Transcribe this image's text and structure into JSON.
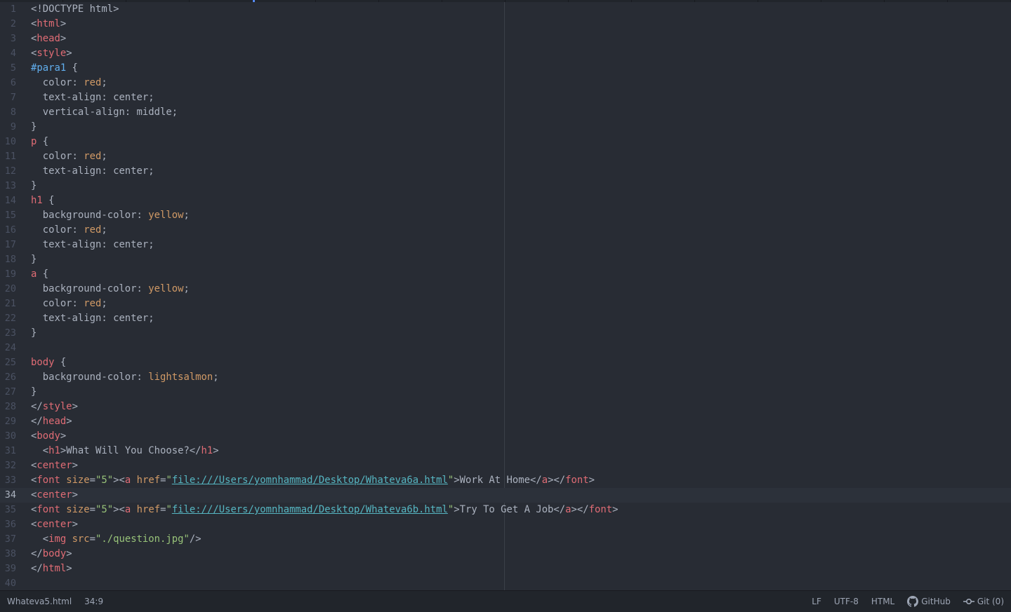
{
  "tabs": [
    "",
    "",
    "",
    "",
    "",
    "",
    "",
    "",
    "",
    "",
    "",
    "",
    "",
    "",
    "",
    ""
  ],
  "editor": {
    "lines": [
      [
        [
          "punc",
          "<!DOCTYPE html>"
        ]
      ],
      [
        [
          "punc",
          "<"
        ],
        [
          "tag",
          "html"
        ],
        [
          "punc",
          ">"
        ]
      ],
      [
        [
          "punc",
          "<"
        ],
        [
          "tag",
          "head"
        ],
        [
          "punc",
          ">"
        ]
      ],
      [
        [
          "punc",
          "<"
        ],
        [
          "tag",
          "style"
        ],
        [
          "punc",
          ">"
        ]
      ],
      [
        [
          "id",
          "#para1"
        ],
        [
          "punc",
          " {"
        ]
      ],
      [
        [
          "punc",
          "  color: "
        ],
        [
          "val",
          "red"
        ],
        [
          "punc",
          ";"
        ]
      ],
      [
        [
          "punc",
          "  text-align: center;"
        ]
      ],
      [
        [
          "punc",
          "  vertical-align: middle;"
        ]
      ],
      [
        [
          "punc",
          "}"
        ]
      ],
      [
        [
          "tag",
          "p"
        ],
        [
          "punc",
          " {"
        ]
      ],
      [
        [
          "punc",
          "  color: "
        ],
        [
          "val",
          "red"
        ],
        [
          "punc",
          ";"
        ]
      ],
      [
        [
          "punc",
          "  text-align: center;"
        ]
      ],
      [
        [
          "punc",
          "}"
        ]
      ],
      [
        [
          "tag",
          "h1"
        ],
        [
          "punc",
          " {"
        ]
      ],
      [
        [
          "punc",
          "  background-color: "
        ],
        [
          "val",
          "yellow"
        ],
        [
          "punc",
          ";"
        ]
      ],
      [
        [
          "punc",
          "  color: "
        ],
        [
          "val",
          "red"
        ],
        [
          "punc",
          ";"
        ]
      ],
      [
        [
          "punc",
          "  text-align: center;"
        ]
      ],
      [
        [
          "punc",
          "}"
        ]
      ],
      [
        [
          "tag",
          "a"
        ],
        [
          "punc",
          " {"
        ]
      ],
      [
        [
          "punc",
          "  background-color: "
        ],
        [
          "val",
          "yellow"
        ],
        [
          "punc",
          ";"
        ]
      ],
      [
        [
          "punc",
          "  color: "
        ],
        [
          "val",
          "red"
        ],
        [
          "punc",
          ";"
        ]
      ],
      [
        [
          "punc",
          "  text-align: center;"
        ]
      ],
      [
        [
          "punc",
          "}"
        ]
      ],
      [],
      [
        [
          "tag",
          "body"
        ],
        [
          "punc",
          " {"
        ]
      ],
      [
        [
          "punc",
          "  background-color: "
        ],
        [
          "val",
          "lightsalmon"
        ],
        [
          "punc",
          ";"
        ]
      ],
      [
        [
          "punc",
          "}"
        ]
      ],
      [
        [
          "punc",
          "</"
        ],
        [
          "tag",
          "style"
        ],
        [
          "punc",
          ">"
        ]
      ],
      [
        [
          "punc",
          "</"
        ],
        [
          "tag",
          "head"
        ],
        [
          "punc",
          ">"
        ]
      ],
      [
        [
          "punc",
          "<"
        ],
        [
          "tag",
          "body"
        ],
        [
          "punc",
          ">"
        ]
      ],
      [
        [
          "punc",
          "  <"
        ],
        [
          "tag",
          "h1"
        ],
        [
          "punc",
          ">What Will You Choose?</"
        ],
        [
          "tag",
          "h1"
        ],
        [
          "punc",
          ">"
        ]
      ],
      [
        [
          "punc",
          "<"
        ],
        [
          "tag",
          "center"
        ],
        [
          "punc",
          ">"
        ]
      ],
      [
        [
          "punc",
          "<"
        ],
        [
          "tag",
          "font"
        ],
        [
          "punc",
          " "
        ],
        [
          "attr",
          "size"
        ],
        [
          "punc",
          "="
        ],
        [
          "str",
          "\"5\""
        ],
        [
          "punc",
          "><"
        ],
        [
          "tag",
          "a"
        ],
        [
          "punc",
          " "
        ],
        [
          "attr",
          "href"
        ],
        [
          "punc",
          "="
        ],
        [
          "str",
          "\""
        ],
        [
          "url",
          "file:///Users/yomnhammad/Desktop/Whateva6a.html"
        ],
        [
          "str",
          "\""
        ],
        [
          "punc",
          ">Work At Home</"
        ],
        [
          "tag",
          "a"
        ],
        [
          "punc",
          "></"
        ],
        [
          "tag",
          "font"
        ],
        [
          "punc",
          ">"
        ]
      ],
      [
        [
          "punc",
          "<"
        ],
        [
          "tag",
          "center"
        ],
        [
          "punc",
          ">"
        ]
      ],
      [
        [
          "punc",
          "<"
        ],
        [
          "tag",
          "font"
        ],
        [
          "punc",
          " "
        ],
        [
          "attr",
          "size"
        ],
        [
          "punc",
          "="
        ],
        [
          "str",
          "\"5\""
        ],
        [
          "punc",
          "><"
        ],
        [
          "tag",
          "a"
        ],
        [
          "punc",
          " "
        ],
        [
          "attr",
          "href"
        ],
        [
          "punc",
          "="
        ],
        [
          "str",
          "\""
        ],
        [
          "url",
          "file:///Users/yomnhammad/Desktop/Whateva6b.html"
        ],
        [
          "str",
          "\""
        ],
        [
          "punc",
          ">Try To Get A Job</"
        ],
        [
          "tag",
          "a"
        ],
        [
          "punc",
          "></"
        ],
        [
          "tag",
          "font"
        ],
        [
          "punc",
          ">"
        ]
      ],
      [
        [
          "punc",
          "<"
        ],
        [
          "tag",
          "center"
        ],
        [
          "punc",
          ">"
        ]
      ],
      [
        [
          "punc",
          "  <"
        ],
        [
          "tag",
          "img"
        ],
        [
          "punc",
          " "
        ],
        [
          "attr",
          "src"
        ],
        [
          "punc",
          "="
        ],
        [
          "str",
          "\"./question.jpg\""
        ],
        [
          "punc",
          "/>"
        ]
      ],
      [
        [
          "punc",
          "</"
        ],
        [
          "tag",
          "body"
        ],
        [
          "punc",
          ">"
        ]
      ],
      [
        [
          "punc",
          "</"
        ],
        [
          "tag",
          "html"
        ],
        [
          "punc",
          ">"
        ]
      ],
      []
    ],
    "cursor_line": 34
  },
  "status": {
    "file_name": "Whateva5.html",
    "cursor_position": "34:9",
    "line_ending": "LF",
    "encoding": "UTF-8",
    "grammar": "HTML",
    "github_label": "GitHub",
    "git_label": "Git (0)"
  },
  "icons": {
    "github": "github-icon",
    "git": "git-commit-icon"
  },
  "colors": {
    "background": "#282c34",
    "tag": "#e06c75",
    "attribute": "#d19a66",
    "string": "#98c379",
    "url": "#56b6c2",
    "id_selector": "#61afef"
  }
}
